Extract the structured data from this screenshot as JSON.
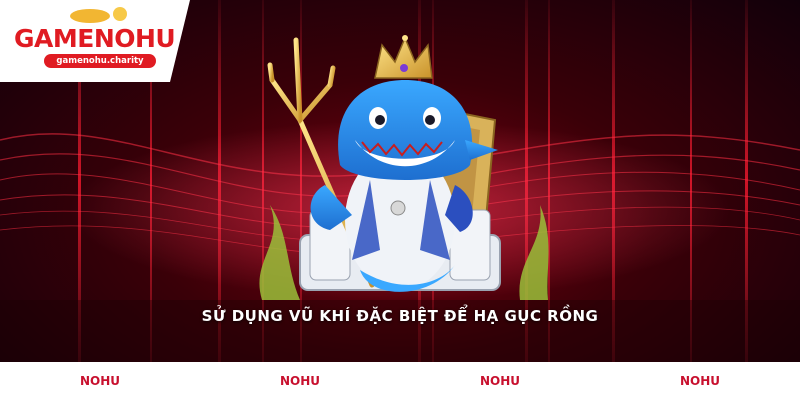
{
  "logo": {
    "brand_part1": "GAME",
    "brand_part2": "NOHU",
    "subtitle": "gamenohu.charity"
  },
  "caption": "SỬ DỤNG VŨ KHÍ ĐẶC BIỆT ĐỂ HẠ GỤC RỒNG",
  "footer": {
    "tabs": [
      "NOHU",
      "NOHU",
      "NOHU",
      "NOHU"
    ]
  },
  "colors": {
    "brand_red": "#e01b22",
    "footer_text": "#c8102e",
    "background_dark": "#1a0004"
  },
  "illustration": {
    "subject": "shark-king-mascot-icon",
    "items": [
      "crown-icon",
      "trident-icon",
      "throne-icon"
    ]
  }
}
